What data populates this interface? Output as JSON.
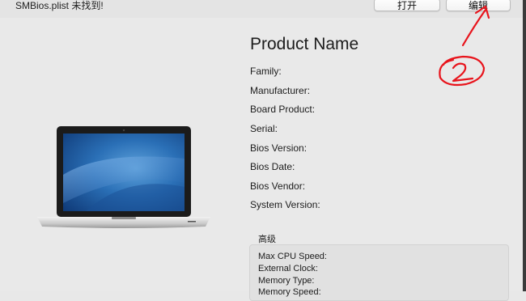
{
  "toolbar": {
    "status": "SMBios.plist 未找到!",
    "open_label": "打开",
    "edit_label": "编辑"
  },
  "product": {
    "name": "Product Name",
    "fields": [
      "Family:",
      "Manufacturer:",
      "Board Product:",
      "Serial:",
      "Bios Version:",
      "Bios Date:",
      "Bios Vendor:",
      "System Version:"
    ]
  },
  "advanced": {
    "title": "高级",
    "fields": [
      "Max CPU Speed:",
      "External Clock:",
      "Memory Type:",
      "Memory Speed:"
    ]
  },
  "annotation": {
    "color": "#e8141c",
    "mark": "2"
  },
  "icons": {
    "laptop": "macbook-pro-image"
  }
}
